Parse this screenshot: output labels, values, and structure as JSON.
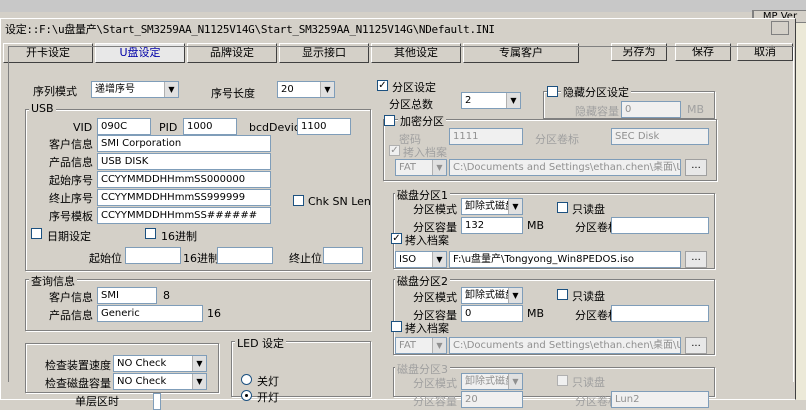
{
  "window": {
    "title": "设定::F:\\u盘量产\\Start_SM3259AA_N1125V14G\\Start_SM3259AA_N1125V14G\\NDefault.INI",
    "right_header": "MP Ver"
  },
  "tabs": [
    "开卡设定",
    "U盘设定",
    "品牌设定",
    "显示接口",
    "其他设定",
    "专属客户"
  ],
  "buttons": {
    "save_as": "另存为",
    "save": "保存",
    "cancel": "取消"
  },
  "serial": {
    "mode_label": "序列模式",
    "mode_value": "递增序号",
    "length_label": "序号长度",
    "length_value": "20"
  },
  "usb": {
    "group": "USB",
    "vid_label": "VID",
    "vid": "090C",
    "pid_label": "PID",
    "pid": "1000",
    "bcd_label": "bcdDevice",
    "bcd": "1100",
    "customer_label": "客户信息",
    "customer": "SMI Corporation",
    "product_label": "产品信息",
    "product": "USB DISK",
    "start_sn_label": "起始序号",
    "start_sn": "CCYYMMDDHHmmSS000000",
    "end_sn_label": "终止序号",
    "end_sn": "CCYYMMDDHHmmSS999999",
    "template_label": "序号模板",
    "template": "CCYYMMDDHHmmSS######",
    "chk_sn_len": "Chk SN Len",
    "date_setting": "日期设定",
    "hex16": "16进制",
    "start_pos": "起始位",
    "hex16b": "16进制",
    "end_pos": "终止位"
  },
  "query": {
    "group": "查询信息",
    "customer_label": "客户信息",
    "customer": "SMI",
    "customer_len": "8",
    "product_label": "产品信息",
    "product": "Generic",
    "product_len": "16"
  },
  "check": {
    "speed_label": "检查装置速度",
    "speed": "NO Check",
    "capacity_label": "检查磁盘容量",
    "capacity": "NO Check",
    "cut_label": "单层区时"
  },
  "led": {
    "group": "LED 设定",
    "off": "关灯",
    "on": "开灯"
  },
  "partition": {
    "label": "分区设定",
    "count_label": "分区总数",
    "count": "2",
    "hidden_label": "隐藏分区设定",
    "hidden_cap_label": "隐藏容量",
    "hidden_cap": "0",
    "unit": "MB"
  },
  "encrypt": {
    "label": "加密分区",
    "pwd_label": "密码",
    "pwd": "1111",
    "vol_label": "分区卷标",
    "vol": "SEC Disk",
    "copy_label": "拷入档案",
    "fs": "FAT",
    "path": "C:\\Documents and Settings\\ethan.chen\\桌面\\USB"
  },
  "disk1": {
    "group": "磁盘分区1",
    "mode_label": "分区模式",
    "mode": "卸除式磁盘",
    "readonly": "只读盘",
    "cap_label": "分区容量",
    "cap": "132",
    "unit": "MB",
    "vol_label": "分区卷标",
    "copy_label": "拷入档案",
    "fs": "ISO",
    "path": "F:\\u盘量产\\Tongyong_Win8PEDOS.iso"
  },
  "disk2": {
    "group": "磁盘分区2",
    "mode_label": "分区模式",
    "mode": "卸除式磁盘",
    "readonly": "只读盘",
    "cap_label": "分区容量",
    "cap": "0",
    "unit": "MB",
    "vol_label": "分区卷标",
    "copy_label": "拷入档案",
    "fs": "FAT",
    "path": "C:\\Documents and Settings\\ethan.chen\\桌面\\USB"
  },
  "disk3": {
    "group": "磁盘分区3",
    "mode_label": "分区模式",
    "mode": "卸除式磁盘",
    "readonly": "只读盘",
    "cap_label": "分区容量",
    "cap": "20",
    "vol_label": "分区卷标",
    "vol": "Lun2"
  },
  "dots": "..."
}
